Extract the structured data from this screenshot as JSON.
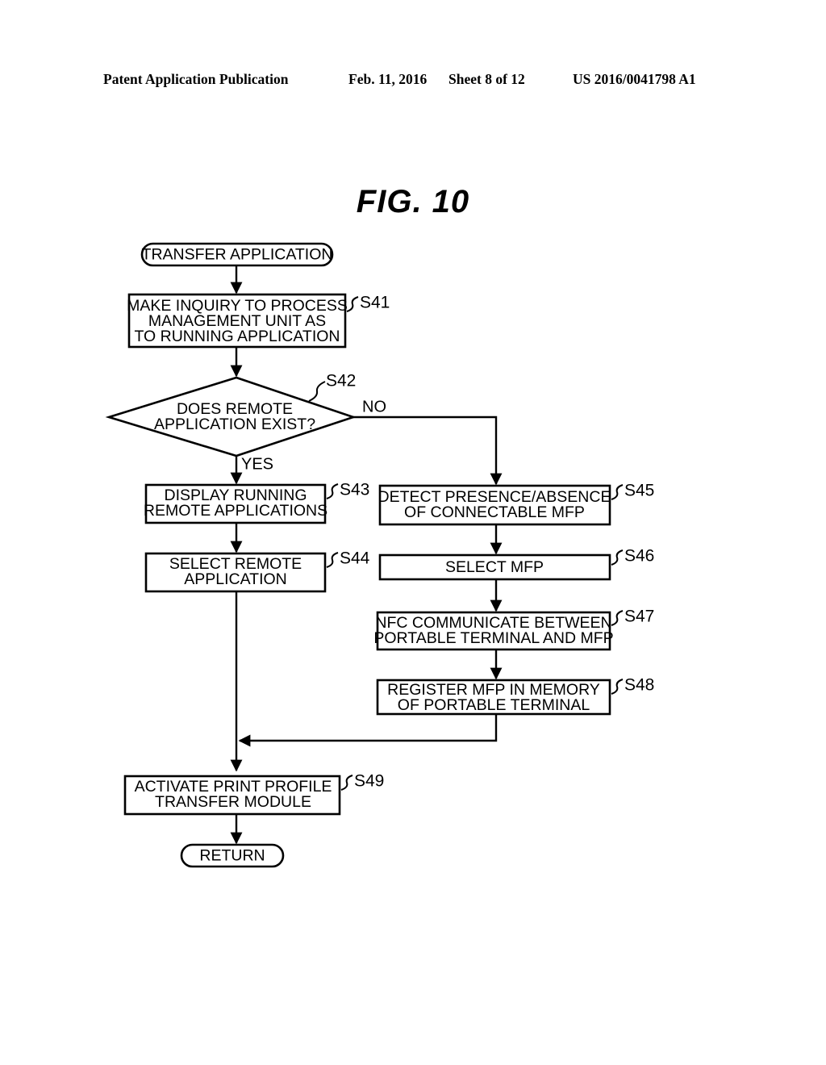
{
  "header": {
    "publication": "Patent Application Publication",
    "date": "Feb. 11, 2016",
    "sheet": "Sheet 8 of 12",
    "number": "US 2016/0041798 A1"
  },
  "figure": {
    "title": "FIG. 10"
  },
  "flowchart": {
    "start_label": "TRANSFER APPLICATION",
    "end_label": "RETURN",
    "yes_label": "YES",
    "no_label": "NO",
    "nodes": [
      {
        "id": "start",
        "type": "terminator",
        "text": "TRANSFER APPLICATION",
        "ref": ""
      },
      {
        "id": "s41",
        "type": "process",
        "lines": [
          "MAKE INQUIRY TO PROCESS",
          "MANAGEMENT UNIT AS",
          "TO RUNNING APPLICATION"
        ],
        "ref": "S41"
      },
      {
        "id": "s42",
        "type": "decision",
        "lines": [
          "DOES REMOTE",
          "APPLICATION EXIST?"
        ],
        "ref": "S42"
      },
      {
        "id": "s43",
        "type": "process",
        "lines": [
          "DISPLAY RUNNING",
          "REMOTE APPLICATIONS"
        ],
        "ref": "S43"
      },
      {
        "id": "s44",
        "type": "process",
        "lines": [
          "SELECT REMOTE",
          "APPLICATION"
        ],
        "ref": "S44"
      },
      {
        "id": "s45",
        "type": "process",
        "lines": [
          "DETECT PRESENCE/ABSENCE",
          "OF CONNECTABLE MFP"
        ],
        "ref": "S45"
      },
      {
        "id": "s46",
        "type": "process",
        "lines": [
          "SELECT MFP"
        ],
        "ref": "S46"
      },
      {
        "id": "s47",
        "type": "process",
        "lines": [
          "NFC COMMUNICATE BETWEEN",
          "PORTABLE TERMINAL AND MFP"
        ],
        "ref": "S47"
      },
      {
        "id": "s48",
        "type": "process",
        "lines": [
          "REGISTER MFP IN MEMORY",
          "OF PORTABLE TERMINAL"
        ],
        "ref": "S48"
      },
      {
        "id": "s49",
        "type": "process",
        "lines": [
          "ACTIVATE PRINT PROFILE",
          "TRANSFER MODULE"
        ],
        "ref": "S49"
      },
      {
        "id": "end",
        "type": "terminator",
        "text": "RETURN",
        "ref": ""
      }
    ]
  },
  "text": {
    "start_title": "TRANSFER APPLICATION",
    "s41_l1": "MAKE INQUIRY TO PROCESS",
    "s41_l2": "MANAGEMENT UNIT AS",
    "s41_l3": "TO RUNNING APPLICATION",
    "s41_ref": "S41",
    "s42_l1": "DOES REMOTE",
    "s42_l2": "APPLICATION EXIST?",
    "s42_ref": "S42",
    "yes": "YES",
    "no": "NO",
    "s43_l1": "DISPLAY RUNNING",
    "s43_l2": "REMOTE APPLICATIONS",
    "s43_ref": "S43",
    "s44_l1": "SELECT REMOTE",
    "s44_l2": "APPLICATION",
    "s44_ref": "S44",
    "s45_l1": "DETECT PRESENCE/ABSENCE",
    "s45_l2": "OF CONNECTABLE MFP",
    "s45_ref": "S45",
    "s46_l1": "SELECT MFP",
    "s46_ref": "S46",
    "s47_l1": "NFC COMMUNICATE BETWEEN",
    "s47_l2": "PORTABLE TERMINAL AND MFP",
    "s47_ref": "S47",
    "s48_l1": "REGISTER MFP IN MEMORY",
    "s48_l2": "OF PORTABLE TERMINAL",
    "s48_ref": "S48",
    "s49_l1": "ACTIVATE PRINT PROFILE",
    "s49_l2": "TRANSFER MODULE",
    "s49_ref": "S49",
    "end_title": "RETURN"
  },
  "colors": {
    "ink": "#000000",
    "paper": "#ffffff"
  }
}
